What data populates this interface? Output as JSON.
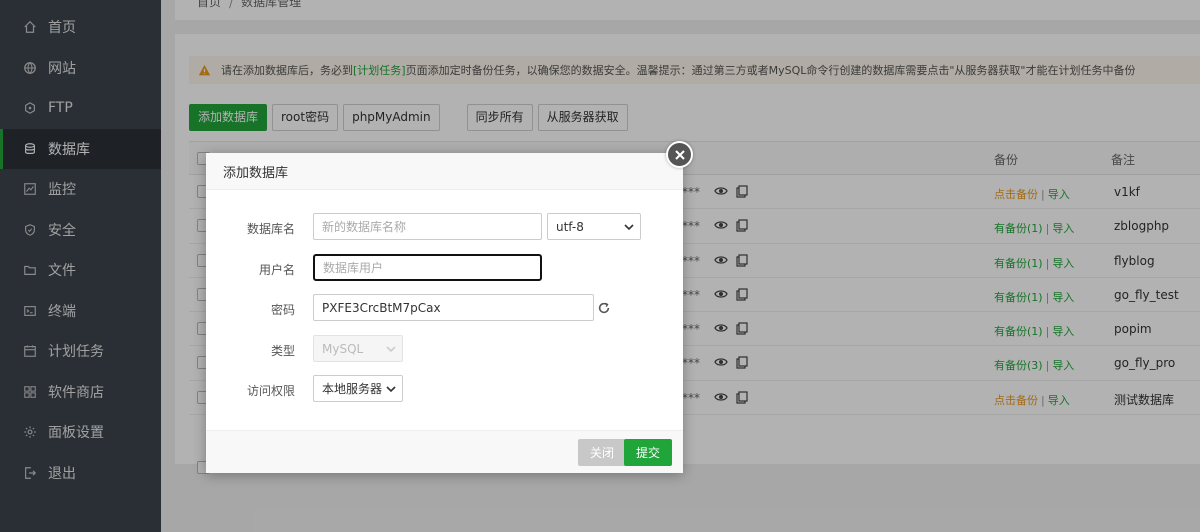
{
  "sidebar": {
    "items": [
      {
        "label": "首页",
        "icon": "home-icon"
      },
      {
        "label": "网站",
        "icon": "globe-icon"
      },
      {
        "label": "FTP",
        "icon": "ftp-icon"
      },
      {
        "label": "数据库",
        "icon": "database-icon",
        "active": true
      },
      {
        "label": "监控",
        "icon": "monitor-icon"
      },
      {
        "label": "安全",
        "icon": "shield-icon"
      },
      {
        "label": "文件",
        "icon": "folder-icon"
      },
      {
        "label": "终端",
        "icon": "terminal-icon"
      },
      {
        "label": "计划任务",
        "icon": "calendar-icon"
      },
      {
        "label": "软件商店",
        "icon": "grid-icon"
      },
      {
        "label": "面板设置",
        "icon": "gear-icon"
      },
      {
        "label": "退出",
        "icon": "logout-icon"
      }
    ]
  },
  "breadcrumb": {
    "home": "首页",
    "current": "数据库管理"
  },
  "alert": {
    "prefix": "请在添加数据库后，务必到",
    "link": "[计划任务]",
    "suffix": "页面添加定时备份任务，以确保您的数据安全。温馨提示：通过第三方或者MySQL命令行创建的数据库需要点击\"从服务器获取\"才能在计划任务中备份"
  },
  "toolbar": {
    "add": "添加数据库",
    "root_pw": "root密码",
    "phpmyadmin": "phpMyAdmin",
    "sync_all": "同步所有",
    "fetch": "从服务器获取"
  },
  "table": {
    "headers": {
      "backup": "备份",
      "note": "备注"
    },
    "rows": [
      {
        "pw": "***",
        "backup": "点击备份",
        "backup_has": false,
        "import": "导入",
        "note": "v1kf"
      },
      {
        "pw": "***",
        "backup": "有备份(1)",
        "backup_has": true,
        "import": "导入",
        "note": "zblogphp"
      },
      {
        "pw": "***",
        "backup": "有备份(1)",
        "backup_has": true,
        "import": "导入",
        "note": "flyblog"
      },
      {
        "pw": "***",
        "backup": "有备份(1)",
        "backup_has": true,
        "import": "导入",
        "note": "go_fly_test"
      },
      {
        "pw": "***",
        "backup": "有备份(1)",
        "backup_has": true,
        "import": "导入",
        "note": "popim"
      },
      {
        "pw": "***",
        "backup": "有备份(3)",
        "backup_has": true,
        "import": "导入",
        "note": "go_fly_pro"
      },
      {
        "pw": "***",
        "backup": "点击备份",
        "backup_has": false,
        "import": "导入",
        "note": "测试数据库"
      }
    ],
    "sep": "|"
  },
  "modal": {
    "title": "添加数据库",
    "fields": {
      "dbname_label": "数据库名",
      "dbname_placeholder": "新的数据库名称",
      "charset": "utf-8",
      "user_label": "用户名",
      "user_placeholder": "数据库用户",
      "pw_label": "密码",
      "pw_value": "PXFE3CrcBtM7pCax",
      "type_label": "类型",
      "type_value": "MySQL",
      "access_label": "访问权限",
      "access_value": "本地服务器"
    },
    "close_btn": "关闭",
    "submit_btn": "提交"
  },
  "colors": {
    "accent": "#20a53a",
    "sidebar": "#3c444d",
    "warn": "#e99a1e"
  }
}
